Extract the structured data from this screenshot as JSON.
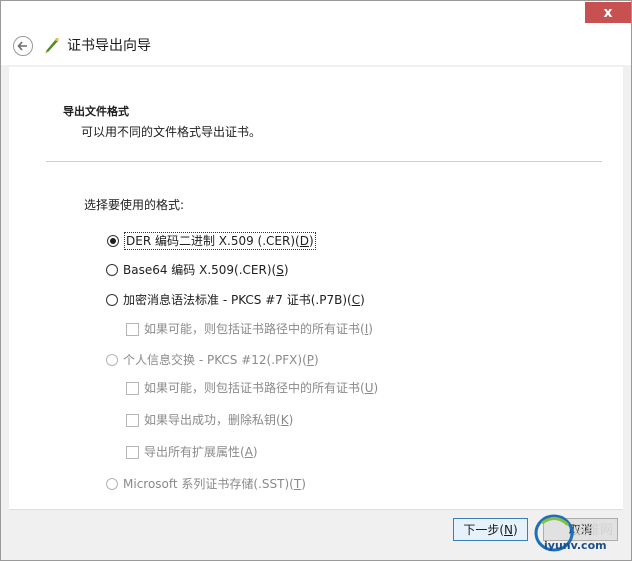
{
  "window": {
    "close_glyph": "x",
    "back_icon": "back-arrow-icon",
    "wizard_icon": "certificate-wizard-icon",
    "title": "证书导出向导"
  },
  "section": {
    "heading": "导出文件格式",
    "description": "可以用不同的文件格式导出证书。"
  },
  "format_prompt": "选择要使用的格式:",
  "options": [
    {
      "label": "DER 编码二进制 X.509 (.CER)(",
      "hotkey": "D",
      "suffix": ")",
      "type": "radio",
      "selected": true,
      "enabled": true
    },
    {
      "label": "Base64 编码 X.509(.CER)(",
      "hotkey": "S",
      "suffix": ")",
      "type": "radio",
      "selected": false,
      "enabled": true
    },
    {
      "label": "加密消息语法标准 - PKCS #7 证书(.P7B)(",
      "hotkey": "C",
      "suffix": ")",
      "type": "radio",
      "selected": false,
      "enabled": true
    },
    {
      "label": "如果可能，则包括证书路径中的所有证书(",
      "hotkey": "I",
      "suffix": ")",
      "type": "checkbox",
      "checked": false,
      "enabled": false
    },
    {
      "label": "个人信息交换 - PKCS #12(.PFX)(",
      "hotkey": "P",
      "suffix": ")",
      "type": "radio",
      "selected": false,
      "enabled": false
    },
    {
      "label": "如果可能，则包括证书路径中的所有证书(",
      "hotkey": "U",
      "suffix": ")",
      "type": "checkbox",
      "checked": false,
      "enabled": false
    },
    {
      "label": "如果导出成功，删除私钥(",
      "hotkey": "K",
      "suffix": ")",
      "type": "checkbox",
      "checked": false,
      "enabled": false
    },
    {
      "label": "导出所有扩展属性(",
      "hotkey": "A",
      "suffix": ")",
      "type": "checkbox",
      "checked": false,
      "enabled": false
    },
    {
      "label": "Microsoft 系列证书存储(.SST)(",
      "hotkey": "T",
      "suffix": ")",
      "type": "radio",
      "selected": false,
      "enabled": false
    }
  ],
  "buttons": {
    "next": {
      "label": "下一步(",
      "hotkey": "N",
      "suffix": ")"
    },
    "cancel": {
      "label": "取消"
    }
  },
  "watermark": {
    "line1": "运维网",
    "line2": "iyunv.com"
  },
  "colors": {
    "close": "#c75050",
    "disabled_text": "#8a8a8a",
    "focus_button_border": "#3c7fb1"
  }
}
